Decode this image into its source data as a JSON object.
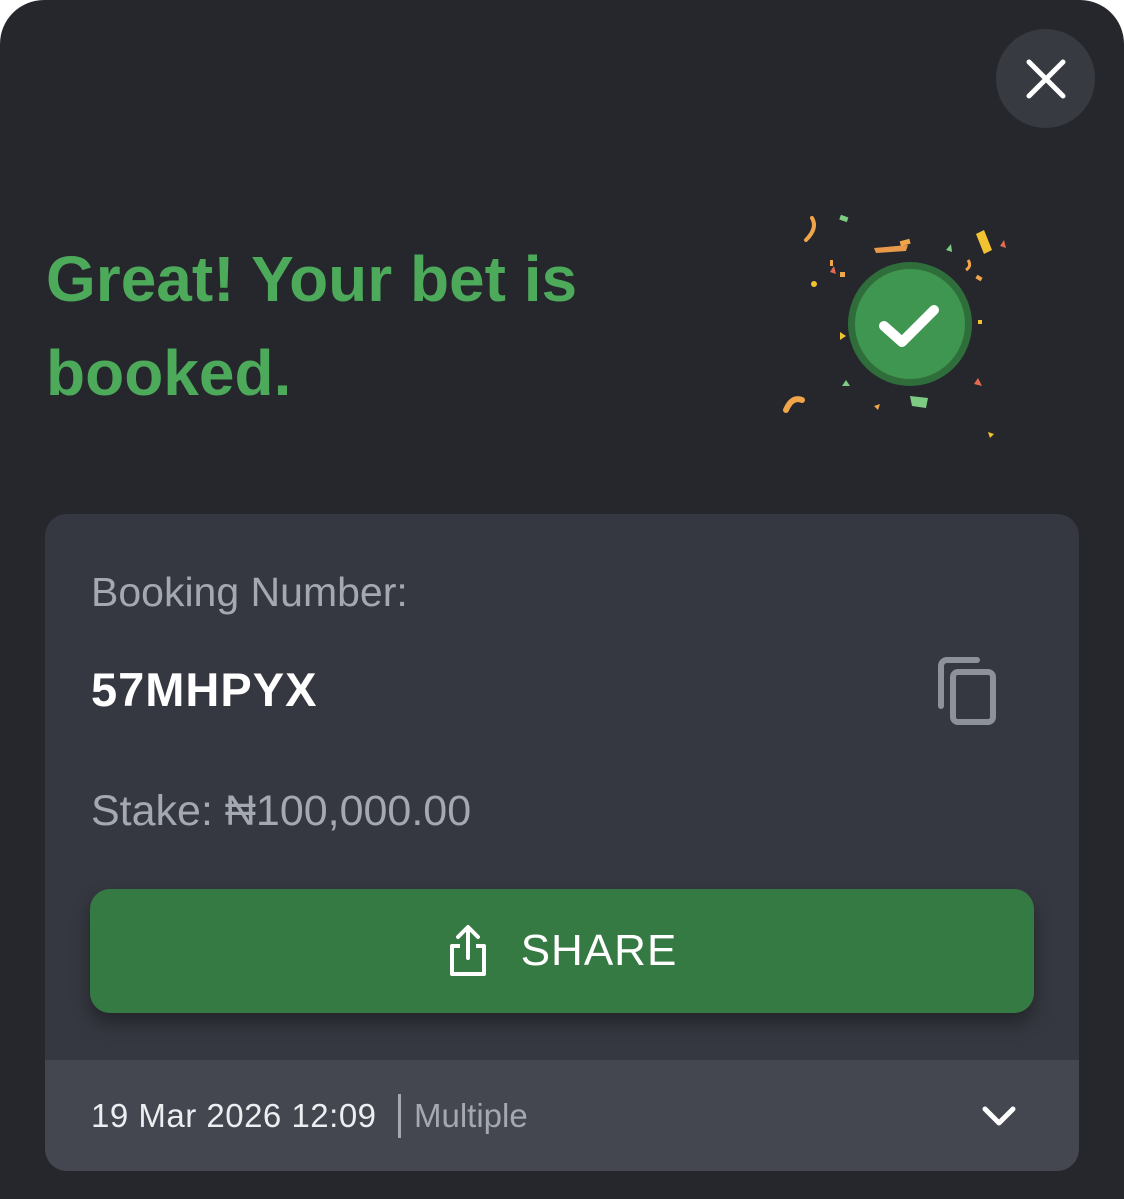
{
  "dialog": {
    "title": "Great! Your bet is booked.",
    "close_icon": "close-icon",
    "success_icon": "check-circle-icon",
    "colors": {
      "background": "#25272c",
      "title": "#4caa5a",
      "card": "#353840",
      "footer": "#444750",
      "share_button": "#367a43",
      "check_circle": "#3e9650"
    }
  },
  "booking": {
    "label": "Booking Number:",
    "number": "57MHPYX",
    "copy_icon": "copy-icon",
    "stake": "Stake: ₦100,000.00"
  },
  "share": {
    "label": "SHARE",
    "icon": "share-icon"
  },
  "footer": {
    "datetime": "19 Mar 2026 12:09",
    "bet_type": "Multiple",
    "expand_icon": "chevron-down-icon"
  }
}
